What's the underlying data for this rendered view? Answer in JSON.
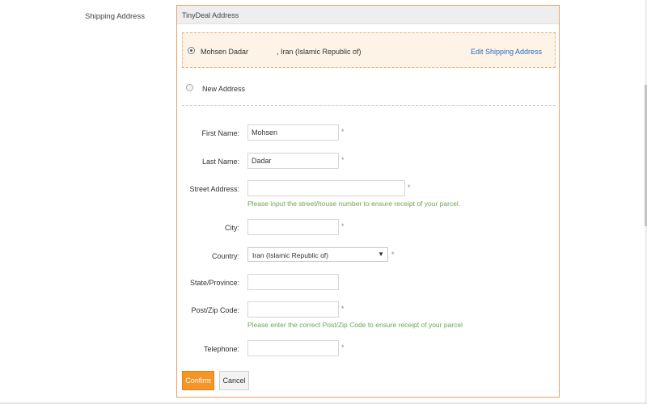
{
  "section_label": "Shipping Address",
  "panel": {
    "title": "TinyDeal Address"
  },
  "saved_address": {
    "name": "Mohsen Dadar",
    "country_text": ", Iran (Islamic Republic of)",
    "edit_link": "Edit Shipping Address",
    "selected": true
  },
  "new_address": {
    "label": "New Address",
    "selected": false
  },
  "form": {
    "first_name": {
      "label": "First Name:",
      "value": "Mohsen",
      "required": "*"
    },
    "last_name": {
      "label": "Last Name:",
      "value": "Dadar",
      "required": "*"
    },
    "street": {
      "label": "Street Address:",
      "value": "",
      "required": "*",
      "hint": "Please input the street/house number to ensure receipt of your parcel."
    },
    "city": {
      "label": "City:",
      "value": "",
      "required": "*"
    },
    "country": {
      "label": "Country:",
      "value": "Iran (Islamic Republic of)",
      "required": "*"
    },
    "state": {
      "label": "State/Province:",
      "value": ""
    },
    "zip": {
      "label": "Post/Zip Code:",
      "value": "",
      "required": "*",
      "hint": "Please enter the correct Post/Zip Code to ensure receipt of your parcel"
    },
    "telephone": {
      "label": "Telephone:",
      "value": "",
      "required": "*"
    }
  },
  "buttons": {
    "confirm": "Confirm",
    "cancel": "Cancel"
  },
  "colors": {
    "accent": "#f59427",
    "link": "#2a6ebb",
    "hint_green": "#6aa84f",
    "panel_border": "#f0a062"
  }
}
